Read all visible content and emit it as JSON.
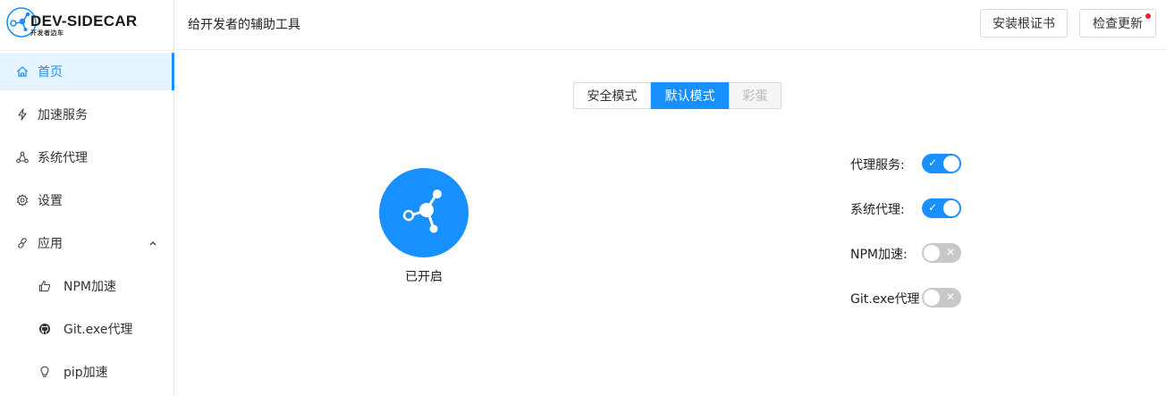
{
  "logo": {
    "title": "DEV-SIDECAR",
    "subtitle": "开发者边车"
  },
  "sidebar": {
    "items": [
      {
        "label": "首页",
        "icon": "home-icon"
      },
      {
        "label": "加速服务",
        "icon": "lightning-icon"
      },
      {
        "label": "系统代理",
        "icon": "network-icon"
      },
      {
        "label": "设置",
        "icon": "gear-icon"
      },
      {
        "label": "应用",
        "icon": "link-icon"
      }
    ],
    "subitems": [
      {
        "label": "NPM加速",
        "icon": "thumbs-up-icon"
      },
      {
        "label": "Git.exe代理",
        "icon": "github-icon"
      },
      {
        "label": "pip加速",
        "icon": "lightbulb-icon"
      }
    ]
  },
  "header": {
    "title": "给开发者的辅助工具",
    "install_cert_label": "安装根证书",
    "check_update_label": "检查更新"
  },
  "modes": {
    "safe": "安全模式",
    "default": "默认模式",
    "egg": "彩蛋"
  },
  "main": {
    "status": "已开启"
  },
  "toggles": [
    {
      "label": "代理服务:",
      "mark": "✓",
      "on": true
    },
    {
      "label": "系统代理:",
      "mark": "✓",
      "on": true
    },
    {
      "label": "NPM加速:",
      "mark": "✕",
      "on": false
    },
    {
      "label": "Git.exe代理",
      "mark": "✕",
      "on": false
    }
  ],
  "colors": {
    "accent": "#1890ff",
    "active_bg": "#e6f4ff",
    "switch_off": "#c8c8c8",
    "badge": "#f5222d"
  }
}
